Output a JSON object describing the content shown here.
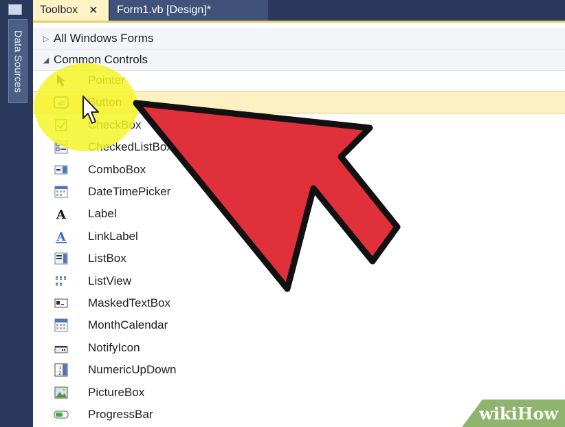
{
  "left_panel": {
    "tab_label": "Data Sources"
  },
  "tabs": [
    {
      "label": "Toolbox",
      "close": "✕"
    },
    {
      "label": "Form1.vb [Design]*"
    }
  ],
  "toolbox": {
    "sections": [
      {
        "label": "All Windows Forms",
        "arrow": "▷"
      },
      {
        "label": "Common Controls",
        "arrow": "◢"
      }
    ],
    "items": [
      {
        "label": "Pointer",
        "icon": "pointer-icon"
      },
      {
        "label": "Button",
        "icon": "button-icon"
      },
      {
        "label": "CheckBox",
        "icon": "checkbox-icon"
      },
      {
        "label": "CheckedListBox",
        "icon": "checkedlistbox-icon"
      },
      {
        "label": "ComboBox",
        "icon": "combobox-icon"
      },
      {
        "label": "DateTimePicker",
        "icon": "datetimepicker-icon"
      },
      {
        "label": "Label",
        "icon": "label-icon"
      },
      {
        "label": "LinkLabel",
        "icon": "linklabel-icon"
      },
      {
        "label": "ListBox",
        "icon": "listbox-icon"
      },
      {
        "label": "ListView",
        "icon": "listview-icon"
      },
      {
        "label": "MaskedTextBox",
        "icon": "maskedtextbox-icon"
      },
      {
        "label": "MonthCalendar",
        "icon": "monthcalendar-icon"
      },
      {
        "label": "NotifyIcon",
        "icon": "notifyicon-icon"
      },
      {
        "label": "NumericUpDown",
        "icon": "numericupdown-icon"
      },
      {
        "label": "PictureBox",
        "icon": "picturebox-icon"
      },
      {
        "label": "ProgressBar",
        "icon": "progressbar-icon"
      }
    ],
    "selected_item": "Button"
  },
  "watermark": {
    "wiki": "wiki",
    "how": "How"
  },
  "colors": {
    "ide_frame": "#2b3a5c",
    "selection": "#fdf0c3",
    "highlight": "#f5f528",
    "arrow": "#e0303a"
  }
}
